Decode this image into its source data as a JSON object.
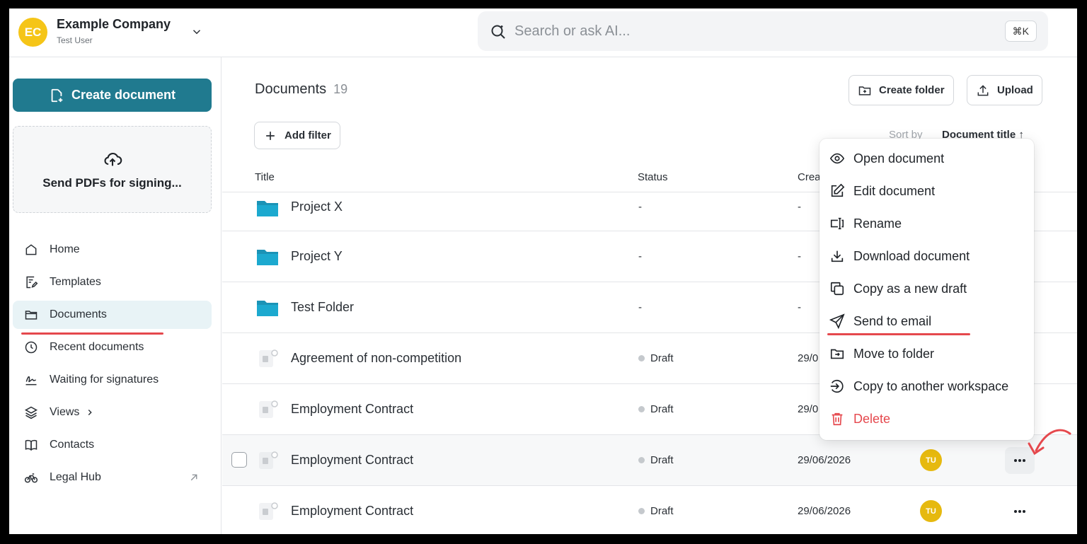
{
  "header": {
    "avatar_initials": "EC",
    "company": "Example Company",
    "user": "Test User",
    "search_placeholder": "Search or ask AI...",
    "search_shortcut": "⌘K"
  },
  "sidebar": {
    "create_label": "Create document",
    "dropzone_label": "Send PDFs for signing...",
    "items": [
      {
        "label": "Home"
      },
      {
        "label": "Templates"
      },
      {
        "label": "Documents"
      },
      {
        "label": "Recent documents"
      },
      {
        "label": "Waiting for signatures"
      },
      {
        "label": "Views"
      },
      {
        "label": "Contacts"
      },
      {
        "label": "Legal Hub"
      }
    ]
  },
  "main": {
    "title": "Documents",
    "count": "19",
    "create_folder_label": "Create folder",
    "upload_label": "Upload",
    "add_filter_label": "Add filter",
    "sort_by_label": "Sort by",
    "sort_value": "Document title ↑",
    "columns": {
      "title": "Title",
      "status": "Status",
      "created": "Crea"
    },
    "rows": [
      {
        "name": "Project X",
        "status": "-",
        "created": "-"
      },
      {
        "name": "Project Y",
        "status": "-",
        "created": "-"
      },
      {
        "name": "Test Folder",
        "status": "-",
        "created": "-"
      },
      {
        "name": "Agreement of non-competition",
        "status": "Draft",
        "created": "29/0"
      },
      {
        "name": "Employment Contract",
        "status": "Draft",
        "created": "29/0"
      },
      {
        "name": "Employment Contract",
        "status": "Draft",
        "created": "29/06/2026",
        "owner": "TU"
      },
      {
        "name": "Employment Contract",
        "status": "Draft",
        "created": "29/06/2026",
        "owner": "TU"
      }
    ]
  },
  "menu": {
    "items": [
      {
        "label": "Open document"
      },
      {
        "label": "Edit document"
      },
      {
        "label": "Rename"
      },
      {
        "label": "Download document"
      },
      {
        "label": "Copy as a new draft"
      },
      {
        "label": "Send to email"
      },
      {
        "label": "Move to folder"
      },
      {
        "label": "Copy to another workspace"
      },
      {
        "label": "Delete"
      }
    ]
  },
  "colors": {
    "brand": "#207a8f",
    "accent_yellow": "#f5c518",
    "danger": "#e5484d"
  }
}
